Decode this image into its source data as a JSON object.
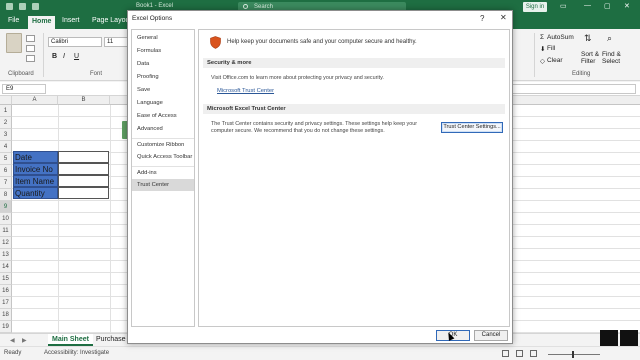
{
  "excel": {
    "doc_title": "Book1 - Excel",
    "search_placeholder": "Search",
    "sign_in": "Sign in",
    "tabs": [
      "File",
      "Home",
      "Insert",
      "Page Layout"
    ],
    "ribbon": {
      "font_name": "Calibri",
      "font_size": "11",
      "bold": "B",
      "italic": "I",
      "underline": "U",
      "clipboard_label": "Clipboard",
      "font_label": "Font",
      "autosum": "AutoSum",
      "fill": "Fill",
      "clear": "Clear",
      "sort_filter": "Sort &",
      "sort_filter2": "Filter",
      "find_select": "Find &",
      "find_select2": "Select",
      "editing_label": "Editing"
    },
    "name_box": "E9",
    "columns": [
      "A",
      "B"
    ],
    "rows": [
      "1",
      "2",
      "3",
      "4",
      "5",
      "6",
      "7",
      "8",
      "9",
      "10",
      "11",
      "12",
      "13",
      "14",
      "15",
      "16",
      "17",
      "18",
      "19",
      "20",
      "21",
      "22",
      "23"
    ],
    "label_cells": [
      "Date",
      "Invoice No",
      "Item Name",
      "Quantity"
    ],
    "sheet_tabs": [
      "Main Sheet",
      "Purchase"
    ],
    "status": {
      "ready": "Ready",
      "accessibility": "Accessibility: Investigate"
    }
  },
  "dialog": {
    "title": "Excel Options",
    "help": "?",
    "close": "✕",
    "nav": [
      "General",
      "Formulas",
      "Data",
      "Proofing",
      "Save",
      "Language",
      "Ease of Access",
      "Advanced",
      "Customize Ribbon",
      "Quick Access Toolbar",
      "Add-ins",
      "Trust Center"
    ],
    "selected_nav": "Trust Center",
    "intro": "Help keep your documents safe and your computer secure and healthy.",
    "security_header": "Security & more",
    "security_text": "Visit Office.com to learn more about protecting your privacy and security.",
    "security_link": "Microsoft Trust Center",
    "trust_header": "Microsoft Excel Trust Center",
    "trust_text_1": "The Trust Center contains security and privacy settings. These settings help keep your",
    "trust_text_2": "computer secure. We recommend that you do not change these settings.",
    "trust_button": "Trust Center Settings...",
    "ok": "OK",
    "cancel": "Cancel"
  },
  "colors": {
    "excel_green": "#1e6e42",
    "label_fill": "#4472c4",
    "shield": "#d9541e"
  }
}
